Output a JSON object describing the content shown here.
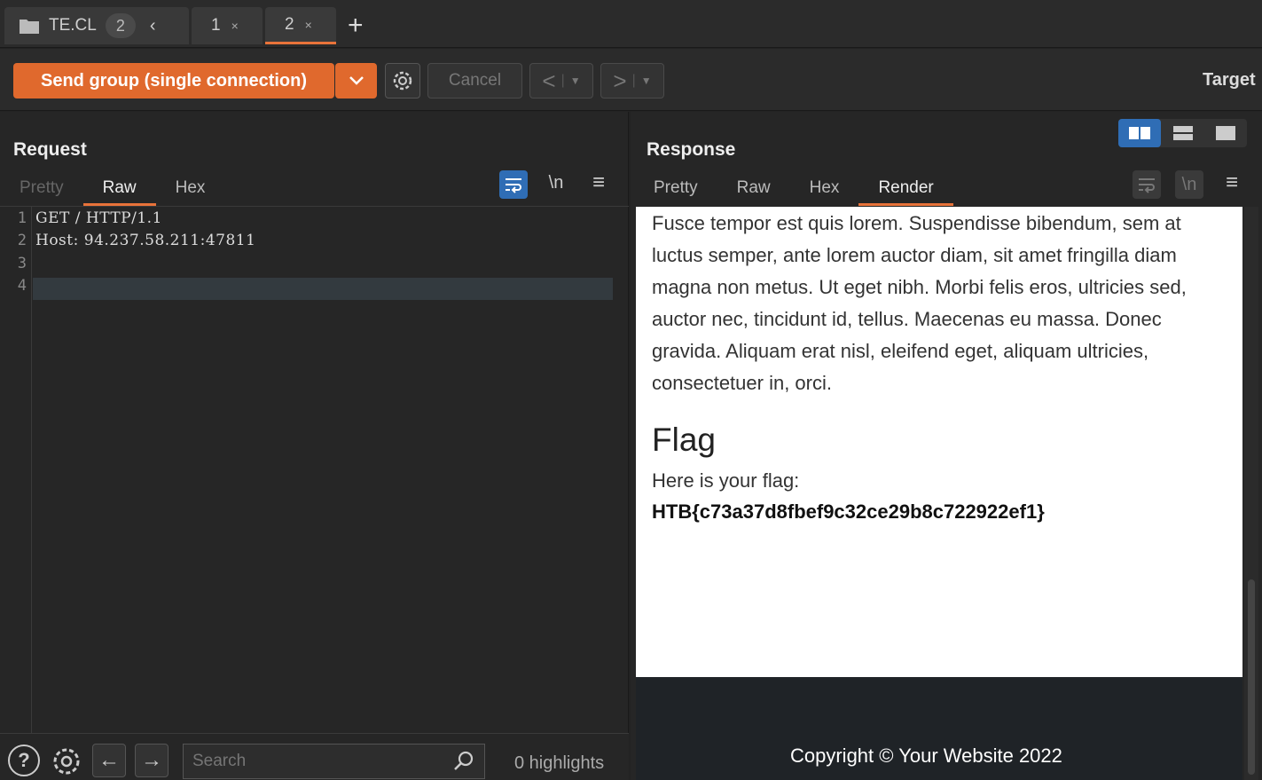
{
  "tabs": {
    "group_label": "TE.CL",
    "group_count": "2",
    "items": [
      {
        "label": "1"
      },
      {
        "label": "2"
      }
    ]
  },
  "toolbar": {
    "send_label": "Send group (single connection)",
    "cancel_label": "Cancel",
    "target_label": "Target"
  },
  "request": {
    "title": "Request",
    "subtabs": [
      "Pretty",
      "Raw",
      "Hex"
    ],
    "active_subtab": "Raw",
    "newline_label": "\\n",
    "line_numbers": [
      "1",
      "2",
      "3",
      "4"
    ],
    "lines": [
      "GET / HTTP/1.1",
      "Host: 94.237.58.211:47811",
      "",
      ""
    ]
  },
  "response": {
    "title": "Response",
    "subtabs": [
      "Pretty",
      "Raw",
      "Hex",
      "Render"
    ],
    "active_subtab": "Render",
    "newline_label": "\\n",
    "render": {
      "paragraph": "Fusce tempor est quis lorem. Suspendisse bibendum, sem at luctus semper, ante lorem auctor diam, sit amet fringilla diam magna non metus. Ut eget nibh. Morbi felis eros, ultricies sed, auctor nec, tincidunt id, tellus. Maecenas eu massa. Donec gravida. Aliquam erat nisl, eleifend eget, aliquam ultricies, consectetuer in, orci.",
      "heading": "Flag",
      "flag_label": "Here is your flag:",
      "flag_value": "HTB{c73a37d8fbef9c32ce29b8c722922ef1}",
      "footer": "Copyright © Your Website 2022"
    }
  },
  "bottombar": {
    "search_placeholder": "Search",
    "highlights": "0 highlights"
  },
  "colors": {
    "accent": "#e0692d",
    "active_view": "#2f6db5"
  }
}
